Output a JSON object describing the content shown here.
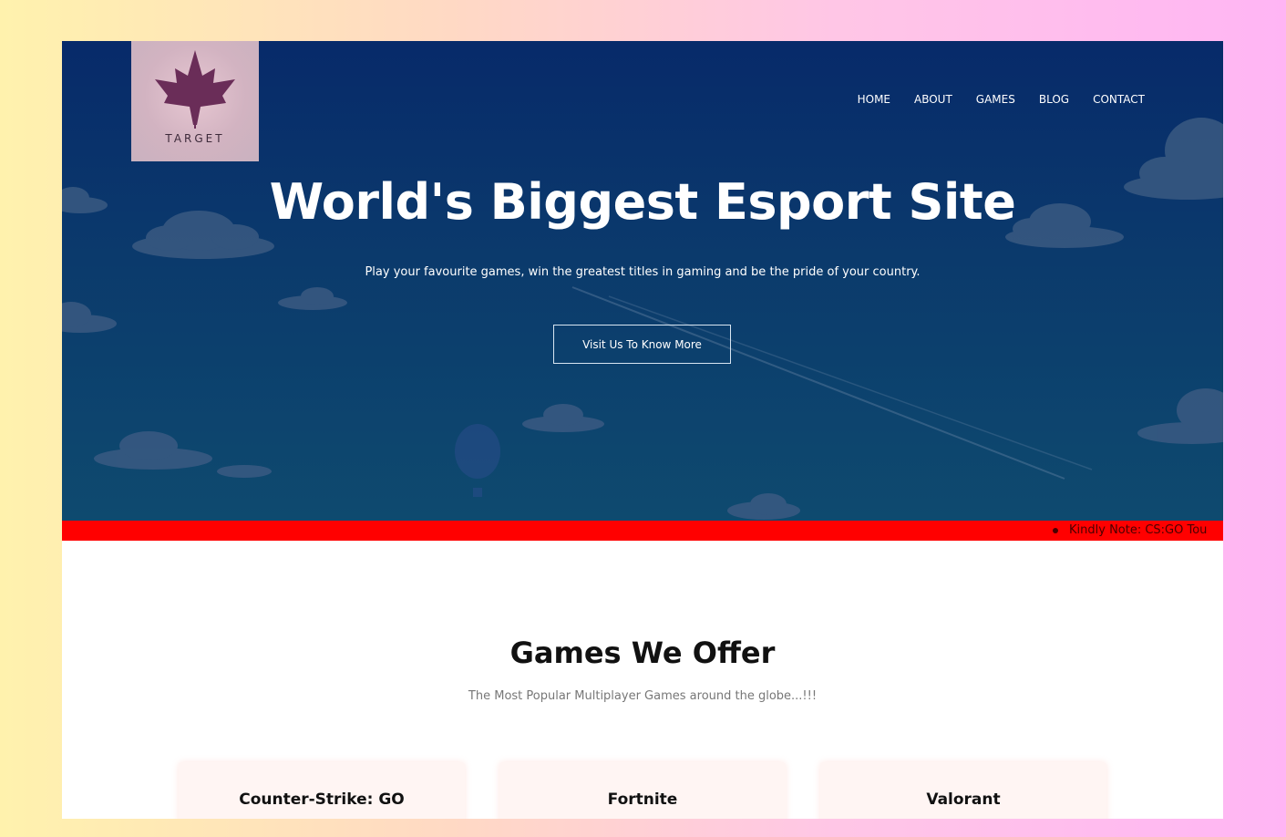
{
  "brand": {
    "logo_text": "TARGET",
    "logo_icon": "maple-leaf-icon"
  },
  "nav": {
    "items": [
      {
        "label": "HOME"
      },
      {
        "label": "ABOUT"
      },
      {
        "label": "GAMES"
      },
      {
        "label": "BLOG"
      },
      {
        "label": "CONTACT"
      }
    ]
  },
  "hero": {
    "title": "World's Biggest Esport Site",
    "subtitle": "Play your favourite games, win the greatest titles in gaming and be the pride of your country.",
    "cta_label": "Visit Us To Know More"
  },
  "ticker": {
    "text": "Kindly Note: CS:GO Tou"
  },
  "games": {
    "title": "Games We Offer",
    "subtitle": "The Most Popular Multiplayer Games around the globe...!!!",
    "cards": [
      {
        "title": "Counter-Strike: GO"
      },
      {
        "title": "Fortnite"
      },
      {
        "title": "Valorant"
      }
    ]
  },
  "colors": {
    "page_gradient_left": "#fff2ad",
    "page_gradient_right": "#ffb5f4",
    "hero_top": "#072a6a",
    "hero_bottom": "#0e4a6f",
    "ticker_bar": "#ff0000",
    "card_bg": "#fff5f3"
  }
}
